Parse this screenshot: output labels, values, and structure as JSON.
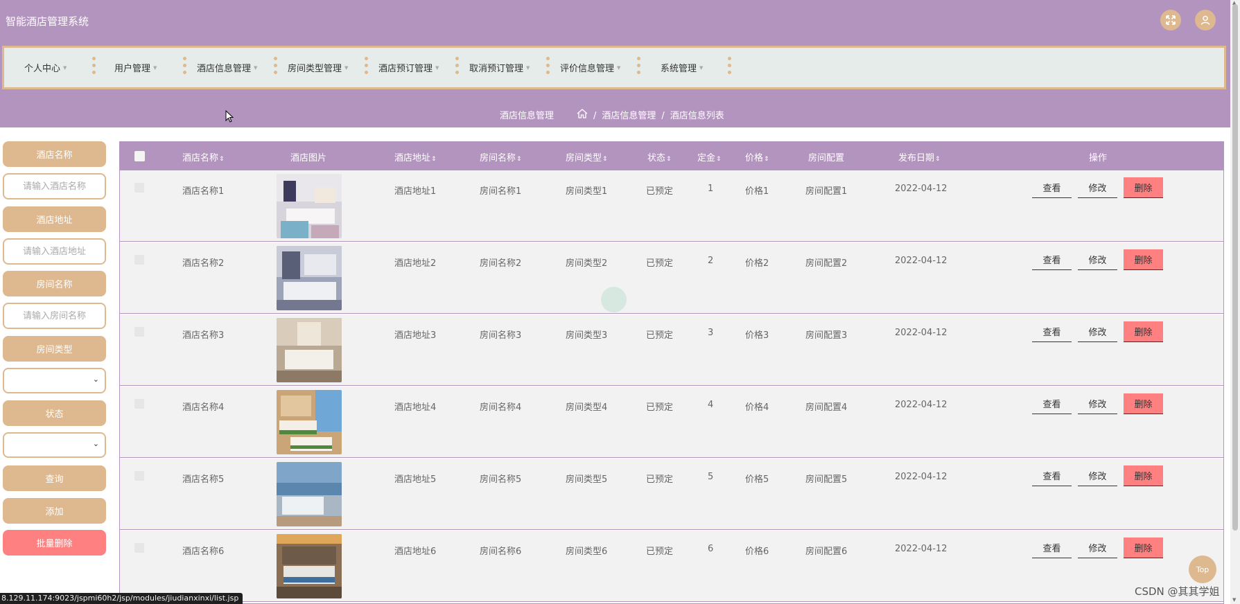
{
  "header": {
    "app_title": "智能酒店管理系统",
    "fullscreen_icon": "expand-arrows-icon",
    "user_icon": "user-icon"
  },
  "nav": {
    "items": [
      "个人中心",
      "用户管理",
      "酒店信息管理",
      "房间类型管理",
      "酒店预订管理",
      "取消预订管理",
      "评价信息管理",
      "系统管理"
    ]
  },
  "breadcrumb": {
    "title": "酒店信息管理",
    "home_icon": "home-icon",
    "level1": "酒店信息管理",
    "level2": "酒店信息列表",
    "separator": "/"
  },
  "sidebar": {
    "hotel_name_label": "酒店名称",
    "hotel_name_placeholder": "请输入酒店名称",
    "hotel_address_label": "酒店地址",
    "hotel_address_placeholder": "请输入酒店地址",
    "room_name_label": "房间名称",
    "room_name_placeholder": "请输入房间名称",
    "room_type_label": "房间类型",
    "room_type_value": "",
    "status_label": "状态",
    "status_value": "",
    "search_button": "查询",
    "add_button": "添加",
    "batch_delete_button": "批量删除"
  },
  "table": {
    "headers": {
      "hotel_name": "酒店名称",
      "hotel_image": "酒店图片",
      "hotel_address": "酒店地址",
      "room_name": "房间名称",
      "room_type": "房间类型",
      "status": "状态",
      "deposit": "定金",
      "price": "价格",
      "room_config": "房间配置",
      "publish_date": "发布日期",
      "actions": "操作"
    },
    "sort_icon": "sort-arrows-icon",
    "actions": {
      "view": "查看",
      "edit": "修改",
      "delete": "删除"
    },
    "rows": [
      {
        "hotel_name": "酒店名称1",
        "hotel_address": "酒店地址1",
        "room_name": "房间名称1",
        "room_type": "房间类型1",
        "status": "已预定",
        "deposit": "1",
        "price": "价格1",
        "room_config": "房间配置1",
        "publish_date": "2022-04-12"
      },
      {
        "hotel_name": "酒店名称2",
        "hotel_address": "酒店地址2",
        "room_name": "房间名称2",
        "room_type": "房间类型2",
        "status": "已预定",
        "deposit": "2",
        "price": "价格2",
        "room_config": "房间配置2",
        "publish_date": "2022-04-12"
      },
      {
        "hotel_name": "酒店名称3",
        "hotel_address": "酒店地址3",
        "room_name": "房间名称3",
        "room_type": "房间类型3",
        "status": "已预定",
        "deposit": "3",
        "price": "价格3",
        "room_config": "房间配置3",
        "publish_date": "2022-04-12"
      },
      {
        "hotel_name": "酒店名称4",
        "hotel_address": "酒店地址4",
        "room_name": "房间名称4",
        "room_type": "房间类型4",
        "status": "已预定",
        "deposit": "4",
        "price": "价格4",
        "room_config": "房间配置4",
        "publish_date": "2022-04-12"
      },
      {
        "hotel_name": "酒店名称5",
        "hotel_address": "酒店地址5",
        "room_name": "房间名称5",
        "room_type": "房间类型5",
        "status": "已预定",
        "deposit": "5",
        "price": "价格5",
        "room_config": "房间配置5",
        "publish_date": "2022-04-12"
      },
      {
        "hotel_name": "酒店名称6",
        "hotel_address": "酒店地址6",
        "room_name": "房间名称6",
        "room_type": "房间类型6",
        "status": "已预定",
        "deposit": "6",
        "price": "价格6",
        "room_config": "房间配置6",
        "publish_date": "2022-04-12"
      }
    ]
  },
  "status_bar": {
    "url": "8.129.11.174:9023/jspmi60h2/jsp/modules/jiudianxinxi/list.jsp"
  },
  "back_to_top": "Top",
  "watermark": "CSDN @其其学姐",
  "colors": {
    "primary": "#b394be",
    "accent": "#deb88f",
    "danger": "#fe8080",
    "nav_bg": "#e6ecea",
    "row_bg": "#f2f2f2"
  }
}
